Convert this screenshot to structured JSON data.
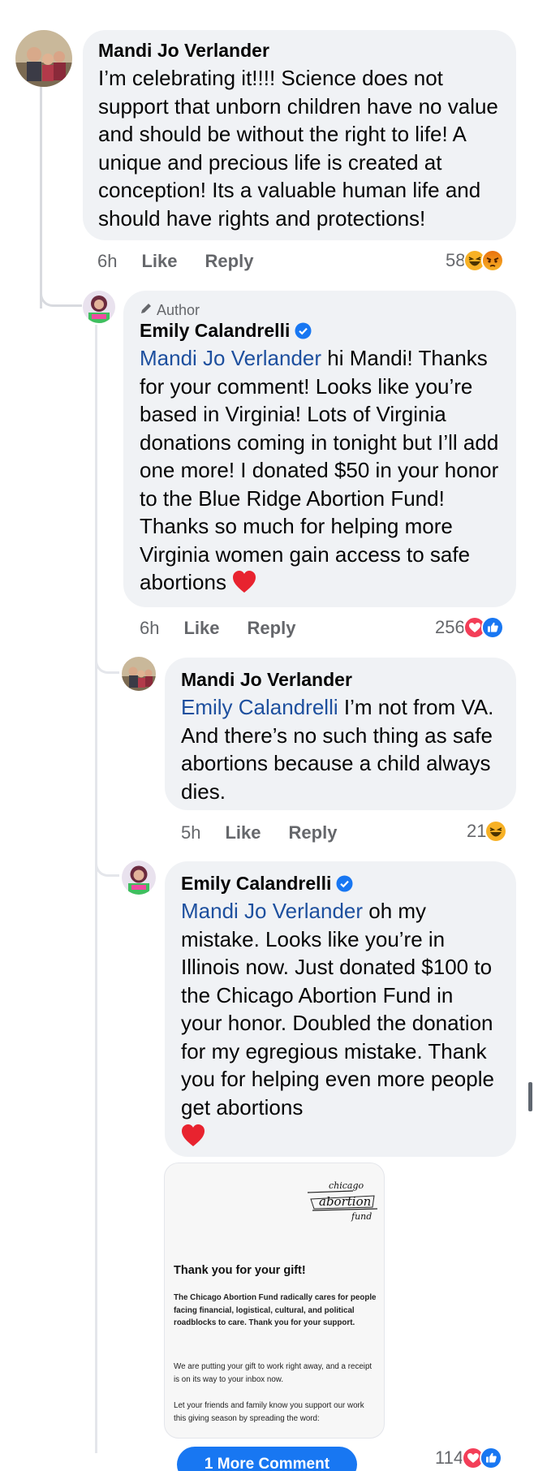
{
  "comments": [
    {
      "author": "Mandi Jo Verlander",
      "text": "I’m celebrating it!!!! Science does not support that unborn children have no value and should be without the right to life! A unique and precious life is created at conception! Its a valuable human life and should have rights and protections!",
      "time": "6h",
      "like_label": "Like",
      "reply_label": "Reply",
      "reaction_count": "58",
      "reaction_icons": [
        "haha-icon",
        "angry-icon"
      ]
    },
    {
      "author_tag": "Author",
      "author": "Emily Calandrelli",
      "mention": "Mandi Jo Verlander",
      "text": " hi Mandi! Thanks for your comment! Looks like you’re based in Virginia! Lots of Virginia donations coming in tonight but I’ll add one more! I donated $50 in your honor to the Blue Ridge Abortion Fund! Thanks so much for helping more Virginia women gain access to safe abortions",
      "time": "6h",
      "like_label": "Like",
      "reply_label": "Reply",
      "reaction_count": "256",
      "reaction_icons": [
        "love-icon",
        "like-icon"
      ]
    },
    {
      "author": "Mandi Jo Verlander",
      "mention": "Emily Calandrelli",
      "text": " I’m not from VA. And there’s no such thing as safe abortions because a child always dies.",
      "time": "5h",
      "like_label": "Like",
      "reply_label": "Reply",
      "reaction_count": "21",
      "reaction_icons": [
        "haha-icon"
      ]
    },
    {
      "author": "Emily Calandrelli",
      "mention": "Mandi Jo Verlander",
      "text": " oh my mistake. Looks like you’re in Illinois now.  Just donated $100 to the Chicago Abortion Fund in your honor. Doubled the donation for my egregious mistake. Thank you for helping even more people get abortions",
      "reaction_count": "114",
      "reaction_icons": [
        "love-icon",
        "like-icon"
      ]
    }
  ],
  "card": {
    "logo_text": [
      "chicago",
      "abortion",
      "fund"
    ],
    "title": "Thank you for your gift!",
    "p1": "The Chicago Abortion Fund radically cares for people facing financial, logistical, cultural, and political roadblocks to care. Thank you for your support.",
    "p2": "We are putting your gift to work right away, and a receipt is on its way to your inbox now.",
    "p3": "Let your friends and family know you support our work this giving season by spreading the word:"
  },
  "more_button": "1 More Comment",
  "colors": {
    "bubble": "#f0f2f5",
    "mention": "#1d4f9e",
    "meta": "#65676b",
    "love": "#f33e58",
    "like": "#1877f2",
    "haha": "#f7b125"
  }
}
